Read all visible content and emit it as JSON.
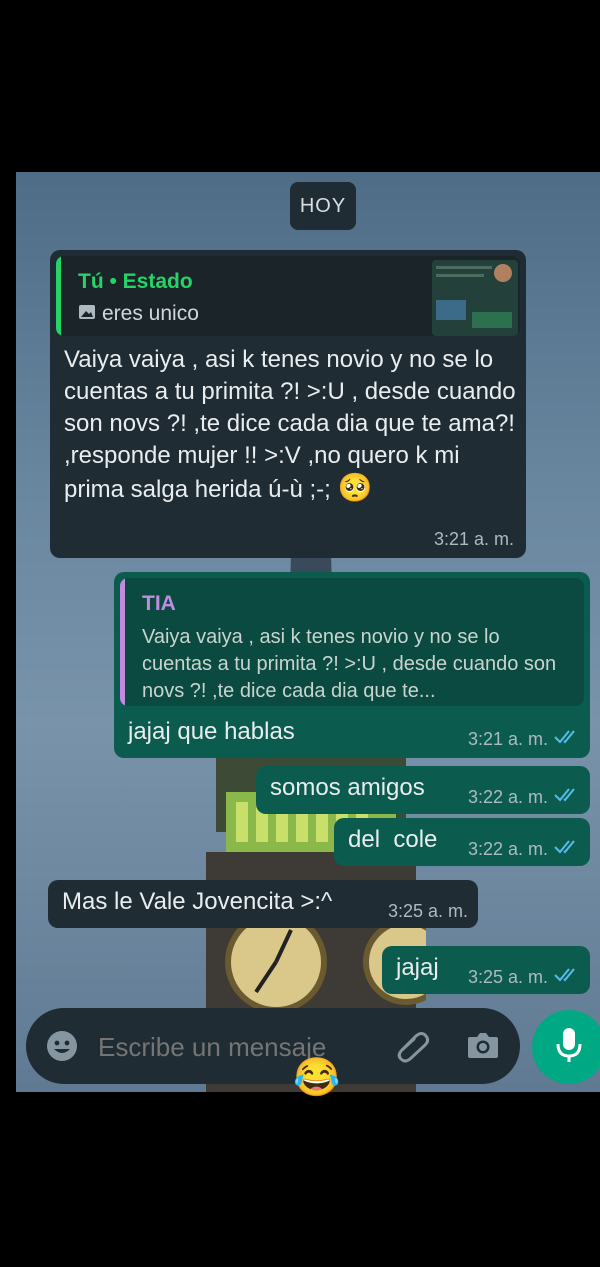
{
  "date_divider": "HOY",
  "status_reply": {
    "author": "Tú • Estado",
    "caption": "eres unico",
    "message": "Vaiya vaiya , asi k tenes novio y no se lo cuentas a tu primita ?! >:U , desde cuando son novs ?! ,te dice cada dia que te ama?! ,responde mujer !! >:V ,no quero k mi prima salga herida ú-ù ;-;",
    "emoji": "🥺",
    "time": "3:21 a. m."
  },
  "reply_message": {
    "quoted_author": "TIA",
    "quoted_text": "Vaiya vaiya , asi k tenes novio y no se lo cuentas a tu primita ?! >:U , desde cuando son novs ?! ,te dice cada dia que te...",
    "text": "jajaj que hablas",
    "time": "3:21 a. m."
  },
  "messages": [
    {
      "text": "somos amigos",
      "time": "3:22 a. m."
    },
    {
      "text": "del  cole",
      "time": "3:22 a. m."
    },
    {
      "text": "Mas le Vale Jovencita >:^",
      "time": "3:25 a. m."
    },
    {
      "text": "jajaj",
      "time": "3:25 a. m."
    }
  ],
  "input": {
    "placeholder": "Escribe un mensaje"
  },
  "below_emoji": "😂",
  "colors": {
    "incoming": "#1f2c33",
    "outgoing": "#0b5c4f",
    "accent": "#00a884",
    "read_ticks": "#53bdeb",
    "quote_author_self": "#25d366",
    "quote_author_other": "#c08be0"
  },
  "icons": [
    "image-icon",
    "double-check-icon",
    "emoji-icon",
    "attach-icon",
    "camera-icon",
    "mic-icon"
  ]
}
